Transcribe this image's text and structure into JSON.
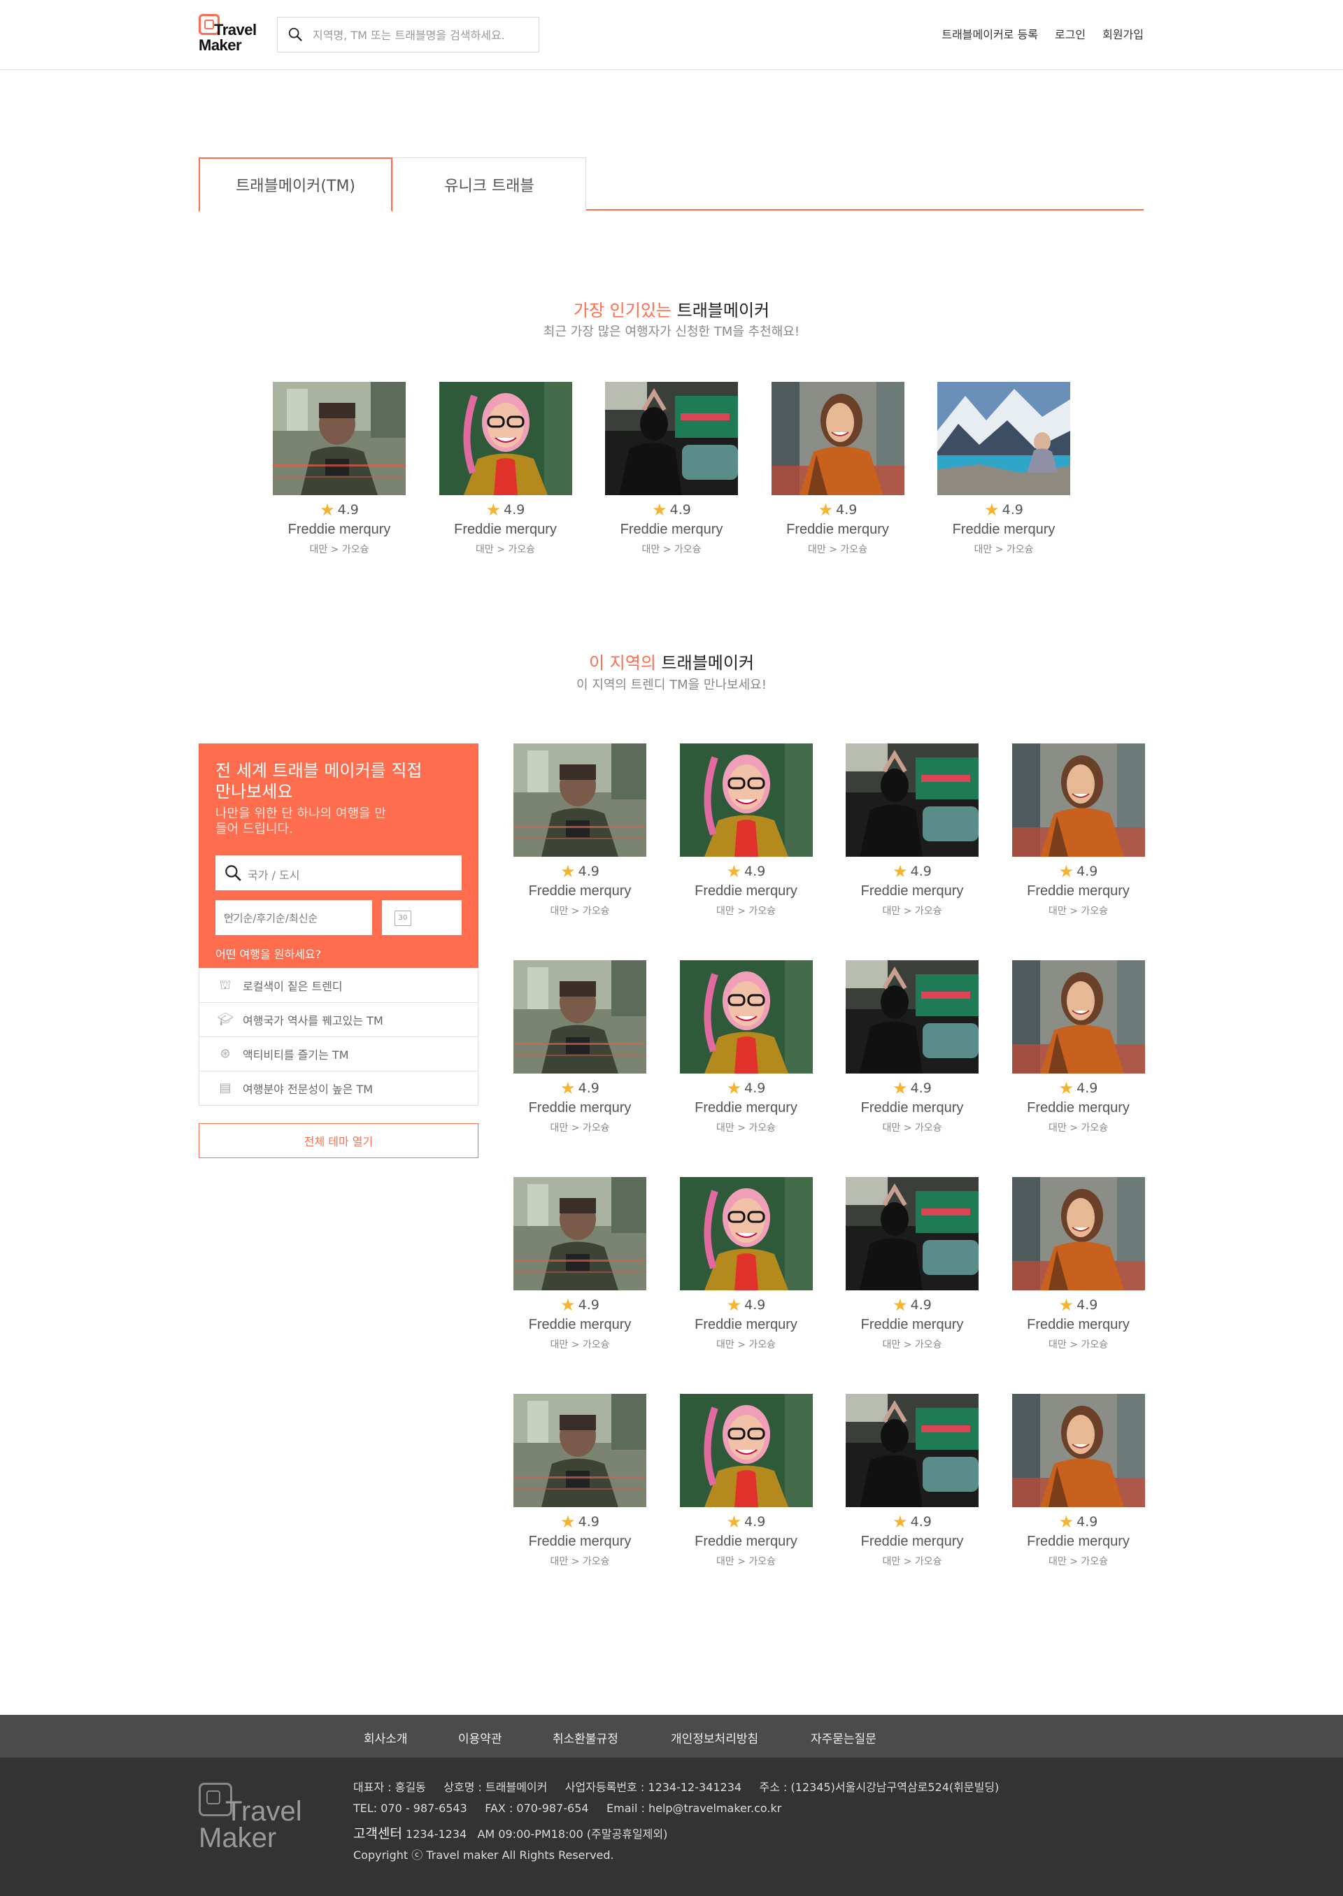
{
  "header": {
    "logo_line1": "Travel",
    "logo_line2": "Maker",
    "search_placeholder": "지역명, TM 또는 트래블명을 검색하세요.",
    "nav": [
      "트래블메이커로 등록",
      "로그인",
      "회원가입"
    ]
  },
  "tabs": [
    {
      "label": "트래블메이커(TM)",
      "active": true
    },
    {
      "label": "유니크 트래블",
      "active": false
    }
  ],
  "popular": {
    "title_accent": "가장 인기있는",
    "title_rest": " 트래블메이커",
    "subtitle": "최근 가장 많은 여행자가 신청한 TM을 추천해요!",
    "cards": [
      {
        "rating": "4.9",
        "name": "Freddie merqury",
        "location": "대만 > 가오슝",
        "photo": "man-camera-photo"
      },
      {
        "rating": "4.9",
        "name": "Freddie merqury",
        "location": "대만 > 가오슝",
        "photo": "woman-glasses-photo"
      },
      {
        "rating": "4.9",
        "name": "Freddie merqury",
        "location": "대만 > 가오슝",
        "photo": "woman-street-photo"
      },
      {
        "rating": "4.9",
        "name": "Freddie merqury",
        "location": "대만 > 가오슝",
        "photo": "woman-smile-photo"
      },
      {
        "rating": "4.9",
        "name": "Freddie merqury",
        "location": "대만 > 가오슝",
        "photo": "mountain-lake-photo"
      }
    ]
  },
  "local": {
    "title_accent": "이 지역의",
    "title_rest": " 트래블메이커",
    "subtitle": "이 지역의 트렌디 TM을 만나보세요!",
    "cards": [
      {
        "rating": "4.9",
        "name": "Freddie merqury",
        "location": "대만 > 가오슝",
        "photo": "man-camera-photo"
      },
      {
        "rating": "4.9",
        "name": "Freddie merqury",
        "location": "대만 > 가오슝",
        "photo": "woman-glasses-photo"
      },
      {
        "rating": "4.9",
        "name": "Freddie merqury",
        "location": "대만 > 가오슝",
        "photo": "woman-street-photo"
      },
      {
        "rating": "4.9",
        "name": "Freddie merqury",
        "location": "대만 > 가오슝",
        "photo": "woman-smile-photo"
      },
      {
        "rating": "4.9",
        "name": "Freddie merqury",
        "location": "대만 > 가오슝",
        "photo": "man-camera-photo"
      },
      {
        "rating": "4.9",
        "name": "Freddie merqury",
        "location": "대만 > 가오슝",
        "photo": "woman-glasses-photo"
      },
      {
        "rating": "4.9",
        "name": "Freddie merqury",
        "location": "대만 > 가오슝",
        "photo": "woman-street-photo"
      },
      {
        "rating": "4.9",
        "name": "Freddie merqury",
        "location": "대만 > 가오슝",
        "photo": "woman-smile-photo"
      },
      {
        "rating": "4.9",
        "name": "Freddie merqury",
        "location": "대만 > 가오슝",
        "photo": "man-camera-photo"
      },
      {
        "rating": "4.9",
        "name": "Freddie merqury",
        "location": "대만 > 가오슝",
        "photo": "woman-glasses-photo"
      },
      {
        "rating": "4.9",
        "name": "Freddie merqury",
        "location": "대만 > 가오슝",
        "photo": "woman-street-photo"
      },
      {
        "rating": "4.9",
        "name": "Freddie merqury",
        "location": "대만 > 가오슝",
        "photo": "woman-smile-photo"
      },
      {
        "rating": "4.9",
        "name": "Freddie merqury",
        "location": "대만 > 가오슝",
        "photo": "man-camera-photo"
      },
      {
        "rating": "4.9",
        "name": "Freddie merqury",
        "location": "대만 > 가오슝",
        "photo": "woman-glasses-photo"
      },
      {
        "rating": "4.9",
        "name": "Freddie merqury",
        "location": "대만 > 가오슝",
        "photo": "woman-street-photo"
      },
      {
        "rating": "4.9",
        "name": "Freddie merqury",
        "location": "대만 > 가오슝",
        "photo": "woman-smile-photo"
      }
    ]
  },
  "side_panel": {
    "title": "전 세계 트래블 메이커를 직접 만나보세요",
    "desc": "나만을 위한 단 하나의 여행을 만들어 드립니다.",
    "search_placeholder": "국가 / 도시",
    "sort_value": "인기순/후기순/최신순",
    "calendar_label": "30",
    "question": "어떤 여행을 원하세요?",
    "themes": [
      {
        "label": "로컬색이 짙은 트렌디",
        "icon": "local-icon"
      },
      {
        "label": "여행국가 역사를 꿰고있는 TM",
        "icon": "graduation-icon"
      },
      {
        "label": "액티비티를 즐기는 TM",
        "icon": "activity-icon"
      },
      {
        "label": "여행분야 전문성이 높은 TM",
        "icon": "book-icon"
      }
    ],
    "all_button": "전체 테마 열기"
  },
  "footer": {
    "nav": [
      "회사소개",
      "이용약관",
      "취소환불규정",
      "개인정보처리방침",
      "자주묻는질문"
    ],
    "logo_line1": "Travel",
    "logo_line2": "Maker",
    "info_line1": "대표자 : 홍길동     상호명 : 트래블메이커     사업자등록번호 : 1234-12-341234     주소 : (12345)서울시강남구역삼로524(휘문빌딩)",
    "info_line2": "TEL: 070 - 987-6543     FAX : 070-987-654     Email : help@travelmaker.co.kr",
    "cs_label": "고객센터",
    "cs_detail": " 1234-1234   AM 09:00-PM18:00 (주말공휴일제외)",
    "copyright": "Copyright ⓒ Travel maker All Rights Reserved."
  },
  "colors": {
    "accent": "#ff6d4f",
    "star": "#f5b32e",
    "footer_nav_bg": "#4b4b4b",
    "footer_bg": "#333333"
  }
}
